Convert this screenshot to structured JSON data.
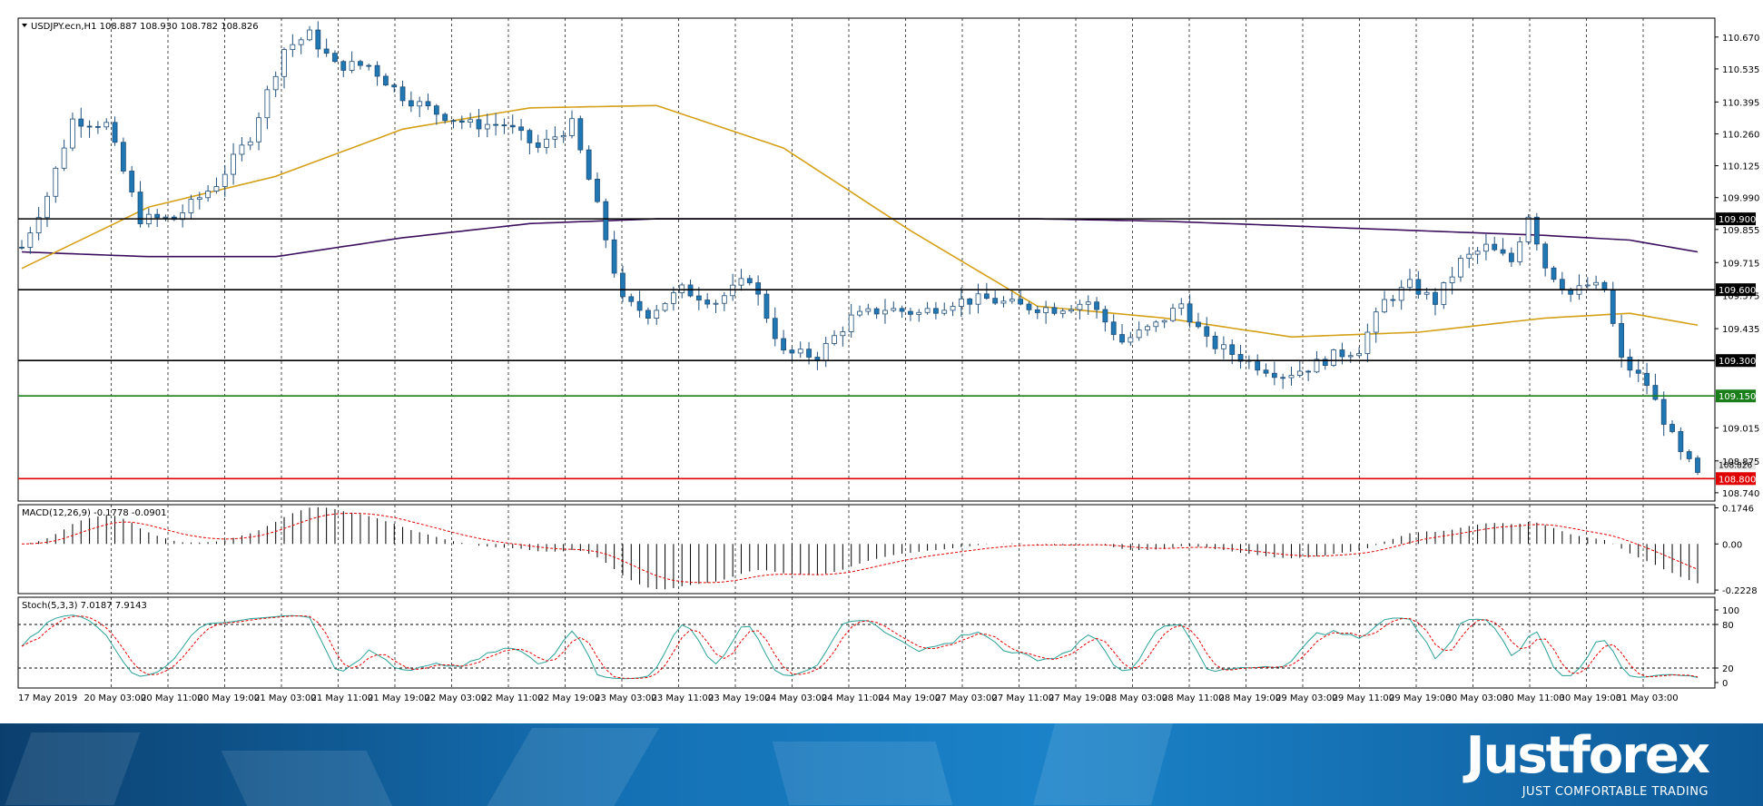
{
  "chart_data": [
    {
      "type": "candlestick",
      "title": "USDJPY.ecn,H1  108.887 108.930 108.782 108.826",
      "symbol": "USDJPY.ecn,H1",
      "last_ohlc": [
        108.887,
        108.93,
        108.782,
        108.826
      ],
      "ylim": [
        108.705,
        110.75
      ],
      "price_ticks": [
        "110.670",
        "110.535",
        "110.395",
        "110.260",
        "110.125",
        "109.990",
        "109.855",
        "109.715",
        "109.575",
        "109.435",
        "109.015",
        "108.875",
        "108.740"
      ],
      "current_price_label": "108.826",
      "x_ticks": [
        "17 May 2019",
        "20 May 03:00",
        "20 May 11:00",
        "20 May 19:00",
        "21 May 03:00",
        "21 May 11:00",
        "21 May 19:00",
        "22 May 03:00",
        "22 May 11:00",
        "22 May 19:00",
        "23 May 03:00",
        "23 May 11:00",
        "23 May 19:00",
        "24 May 03:00",
        "24 May 11:00",
        "24 May 19:00",
        "27 May 03:00",
        "27 May 11:00",
        "27 May 19:00",
        "28 May 03:00",
        "28 May 11:00",
        "28 May 19:00",
        "29 May 03:00",
        "29 May 11:00",
        "29 May 19:00",
        "30 May 03:00",
        "30 May 11:00",
        "30 May 19:00",
        "31 May 03:00"
      ],
      "horizontal_levels": [
        {
          "value": 109.9,
          "label": "109.900",
          "color": "#000000"
        },
        {
          "value": 109.6,
          "label": "109.600",
          "color": "#000000"
        },
        {
          "value": 109.3,
          "label": "109.300",
          "color": "#000000"
        },
        {
          "value": 109.15,
          "label": "109.150",
          "color": "#1a7f1a"
        },
        {
          "value": 108.8,
          "label": "108.800",
          "color": "#e00000"
        }
      ],
      "path_anchors": [
        [
          0,
          109.78
        ],
        [
          3,
          110.0
        ],
        [
          6,
          110.32
        ],
        [
          10,
          110.3
        ],
        [
          14,
          109.9
        ],
        [
          18,
          109.9
        ],
        [
          23,
          110.05
        ],
        [
          27,
          110.25
        ],
        [
          31,
          110.62
        ],
        [
          34,
          110.68
        ],
        [
          37,
          110.55
        ],
        [
          41,
          110.55
        ],
        [
          45,
          110.42
        ],
        [
          49,
          110.35
        ],
        [
          53,
          110.3
        ],
        [
          57,
          110.3
        ],
        [
          61,
          110.2
        ],
        [
          65,
          110.3
        ],
        [
          68,
          109.95
        ],
        [
          71,
          109.55
        ],
        [
          74,
          109.5
        ],
        [
          78,
          109.6
        ],
        [
          82,
          109.55
        ],
        [
          86,
          109.65
        ],
        [
          90,
          109.33
        ],
        [
          94,
          109.32
        ],
        [
          98,
          109.48
        ],
        [
          102,
          109.52
        ],
        [
          106,
          109.5
        ],
        [
          110,
          109.55
        ],
        [
          114,
          109.56
        ],
        [
          118,
          109.53
        ],
        [
          122,
          109.52
        ],
        [
          126,
          109.55
        ],
        [
          130,
          109.38
        ],
        [
          134,
          109.45
        ],
        [
          137,
          109.54
        ],
        [
          140,
          109.38
        ],
        [
          143,
          109.33
        ],
        [
          146,
          109.28
        ],
        [
          149,
          109.24
        ],
        [
          152,
          109.27
        ],
        [
          155,
          109.32
        ],
        [
          158,
          109.35
        ],
        [
          161,
          109.55
        ],
        [
          164,
          109.62
        ],
        [
          167,
          109.55
        ],
        [
          170,
          109.72
        ],
        [
          173,
          109.78
        ],
        [
          176,
          109.72
        ],
        [
          178,
          109.92
        ],
        [
          180,
          109.7
        ],
        [
          183,
          109.58
        ],
        [
          185,
          109.62
        ],
        [
          187,
          109.6
        ],
        [
          189,
          109.3
        ],
        [
          192,
          109.2
        ],
        [
          194,
          109.05
        ],
        [
          196,
          108.9
        ],
        [
          198,
          108.826
        ]
      ],
      "sma_fast_anchors": [
        [
          0,
          109.69
        ],
        [
          15,
          109.95
        ],
        [
          30,
          110.08
        ],
        [
          45,
          110.28
        ],
        [
          60,
          110.37
        ],
        [
          75,
          110.38
        ],
        [
          90,
          110.2
        ],
        [
          105,
          109.85
        ],
        [
          120,
          109.53
        ],
        [
          135,
          109.48
        ],
        [
          150,
          109.4
        ],
        [
          165,
          109.42
        ],
        [
          180,
          109.48
        ],
        [
          190,
          109.5
        ],
        [
          198,
          109.45
        ]
      ],
      "sma_slow_anchors": [
        [
          0,
          109.76
        ],
        [
          15,
          109.74
        ],
        [
          30,
          109.74
        ],
        [
          45,
          109.82
        ],
        [
          60,
          109.88
        ],
        [
          75,
          109.9
        ],
        [
          90,
          109.9
        ],
        [
          105,
          109.9
        ],
        [
          120,
          109.9
        ],
        [
          135,
          109.89
        ],
        [
          150,
          109.87
        ],
        [
          165,
          109.85
        ],
        [
          180,
          109.83
        ],
        [
          190,
          109.81
        ],
        [
          198,
          109.76
        ]
      ],
      "candles_count": 199,
      "colors": {
        "bull": "#ffffff",
        "bear": "#1f77b4",
        "sma_fast": "#d4a017",
        "sma_slow": "#3b0f5e"
      }
    },
    {
      "type": "histogram",
      "title": "MACD(12,26,9) -0.1778 -0.0901",
      "ylim": [
        -0.24,
        0.19
      ],
      "ticks": [
        "0.1746",
        "0.00",
        "-0.2228"
      ],
      "signal_color": "#e00000"
    },
    {
      "type": "line",
      "title": "Stoch(5,3,3) 7.0187 7.9143",
      "ylim": [
        0,
        100
      ],
      "ticks": [
        "100",
        "80",
        "20",
        "0"
      ],
      "levels": [
        80,
        20
      ],
      "main_color": "#2aa198",
      "signal_color": "#e00000"
    }
  ],
  "footer": {
    "brand": "Justforex",
    "tagline": "JUST COMFORTABLE TRADING"
  }
}
